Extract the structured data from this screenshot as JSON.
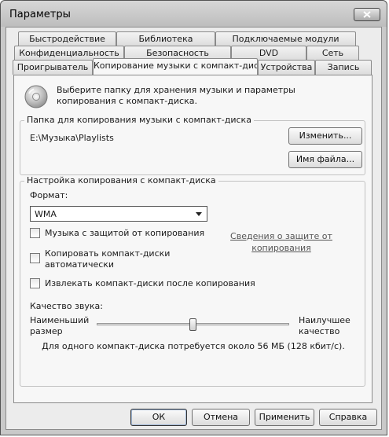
{
  "window": {
    "title": "Параметры"
  },
  "tabs": {
    "row1": [
      "Быстродействие",
      "Библиотека",
      "Подключаемые модули"
    ],
    "row2": [
      "Конфиденциальность",
      "Безопасность",
      "DVD",
      "Сеть"
    ],
    "row3": [
      "Проигрыватель",
      "Копирование музыки с компакт-диска",
      "Устройства",
      "Запись"
    ],
    "active": "Копирование музыки с компакт-диска"
  },
  "intro": "Выберите папку для хранения музыки и параметры копирования с компакт-диска.",
  "folder_group": {
    "title": "Папка для копирования музыки с компакт-диска",
    "path": "E:\\Музыка\\Playlists",
    "change_label": "Изменить...",
    "filename_label": "Имя файла..."
  },
  "rip_group": {
    "title": "Настройка копирования с компакт-диска",
    "format_label": "Формат:",
    "format_value": "WMA",
    "copy_protect_label": "Музыка с защитой от копирования",
    "copy_protect_checked": false,
    "info_link": "Сведения о защите от копирования",
    "auto_rip_label": "Копировать компакт-диски автоматически",
    "auto_rip_checked": false,
    "eject_label": "Извлекать компакт-диски после копирования",
    "eject_checked": false,
    "quality_label": "Качество звука:",
    "min_label": "Наименьший размер",
    "max_label": "Наилучшее качество",
    "quality_slider": 0.5,
    "estimate": "Для одного компакт-диска потребуется около 56 МБ (128 кбит/с)."
  },
  "footer": {
    "ok": "ОК",
    "cancel": "Отмена",
    "apply": "Применить",
    "help": "Справка"
  }
}
